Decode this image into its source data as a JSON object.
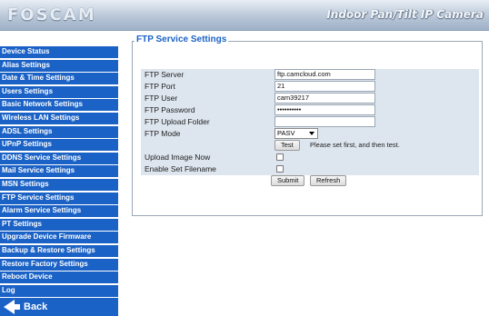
{
  "header": {
    "brand": "FOSCAM",
    "product": "Indoor Pan/Tilt IP Camera"
  },
  "sidebar": {
    "items": [
      "Device Status",
      "Alias Settings",
      "Date & Time Settings",
      "Users Settings",
      "Basic Network Settings",
      "Wireless LAN Settings",
      "ADSL Settings",
      "UPnP Settings",
      "DDNS Service Settings",
      "Mail Service Settings",
      "MSN Settings",
      "FTP Service Settings",
      "Alarm Service Settings",
      "PT Settings",
      "Upgrade Device Firmware",
      "Backup & Restore Settings",
      "Restore Factory Settings",
      "Reboot Device",
      "Log"
    ],
    "back_label": "Back"
  },
  "panel": {
    "title": "FTP Service Settings",
    "fields": {
      "ftp_server": {
        "label": "FTP Server",
        "value": "ftp.camcloud.com"
      },
      "ftp_port": {
        "label": "FTP Port",
        "value": "21"
      },
      "ftp_user": {
        "label": "FTP User",
        "value": "cam39217"
      },
      "ftp_password": {
        "label": "FTP Password",
        "value": "••••••••••"
      },
      "ftp_upload_folder": {
        "label": "FTP Upload Folder",
        "value": ""
      },
      "ftp_mode": {
        "label": "FTP Mode",
        "value": "PASV"
      }
    },
    "test_button": "Test",
    "test_hint": "Please set first, and then test.",
    "upload_image_now": {
      "label": "Upload Image Now",
      "checked": false
    },
    "enable_set_filename": {
      "label": "Enable Set Filename",
      "checked": false
    },
    "submit_button": "Submit",
    "refresh_button": "Refresh"
  }
}
